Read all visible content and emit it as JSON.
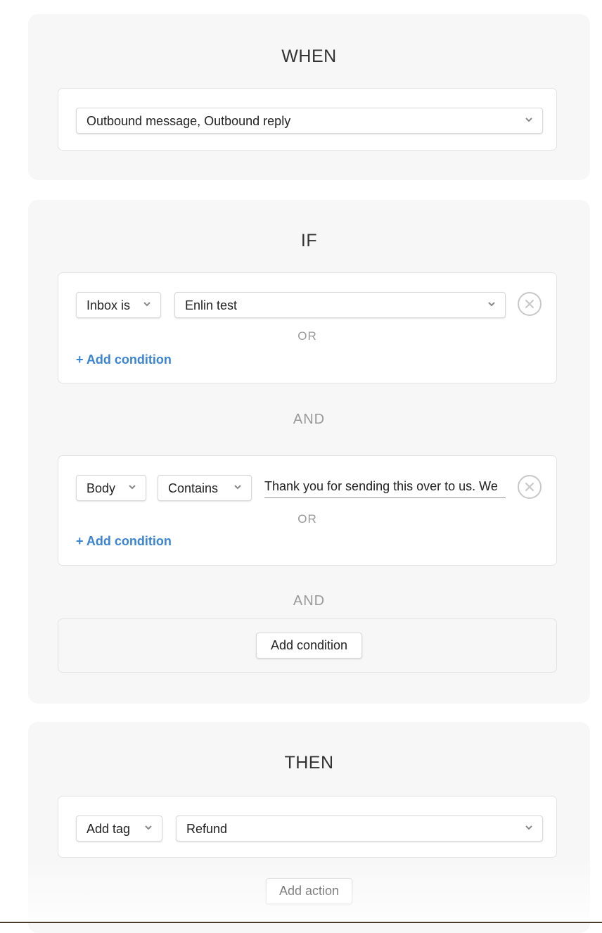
{
  "when": {
    "title": "WHEN",
    "trigger_value": "Outbound message, Outbound reply"
  },
  "if": {
    "title": "IF",
    "groups": [
      {
        "field": "Inbox is",
        "value": "Enlin test",
        "or_label": "OR",
        "add_condition": "+ Add condition"
      },
      {
        "field": "Body",
        "operator": "Contains",
        "text_value": "Thank you for sending this over to us. We",
        "or_label": "OR",
        "add_condition": "+ Add condition"
      }
    ],
    "and_labels": [
      "AND",
      "AND"
    ],
    "add_condition_button": "Add condition"
  },
  "then": {
    "title": "THEN",
    "action": "Add tag",
    "action_value": "Refund",
    "add_action_button": "Add action"
  },
  "colors": {
    "link": "#3a84d6",
    "section_bg": "#f7f7f7",
    "muted": "#999999"
  }
}
